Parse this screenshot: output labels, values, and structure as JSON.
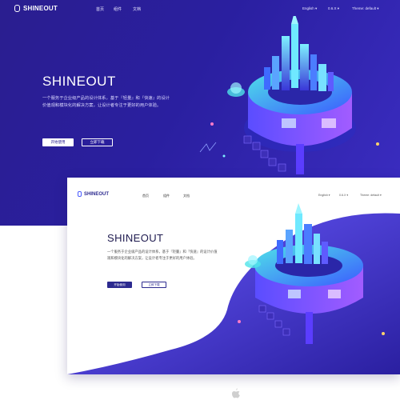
{
  "brand": "SHINEOUT",
  "nav": {
    "items": [
      "首页",
      "组件",
      "文档"
    ],
    "language": "English",
    "version": "0.6.X",
    "theme": "Theme: default"
  },
  "hero": {
    "title": "SHINEOUT",
    "description": "一个服务于企业级产品的设计体系，基于『轻量』和『快速』的设计价值观和模块化的解决方案，让设计者专注于更好的用户体验。",
    "primary_button": "开始使用",
    "secondary_button": "立即下载"
  },
  "preview": {
    "brand": "SHINEOUT",
    "nav": {
      "items": [
        "首页",
        "组件",
        "文档"
      ],
      "language": "English",
      "version": "0.6.X",
      "theme": "Theme: default"
    },
    "title": "SHINEOUT",
    "description": "一个服务于企业级产品的设计体系，基于『轻量』和『快速』的设计价值观和模块化的解决方案，让设计者专注于更好的用户体验。",
    "primary_button": "开始使用",
    "secondary_button": "立即下载"
  },
  "colors": {
    "hero_bg": "#2a1fa0",
    "accent": "#4b5cff",
    "teal": "#38d6e0",
    "dark_text": "#1e1a4f"
  },
  "icons": [
    "logo-icon",
    "chevron-down-icon",
    "apple-icon"
  ]
}
